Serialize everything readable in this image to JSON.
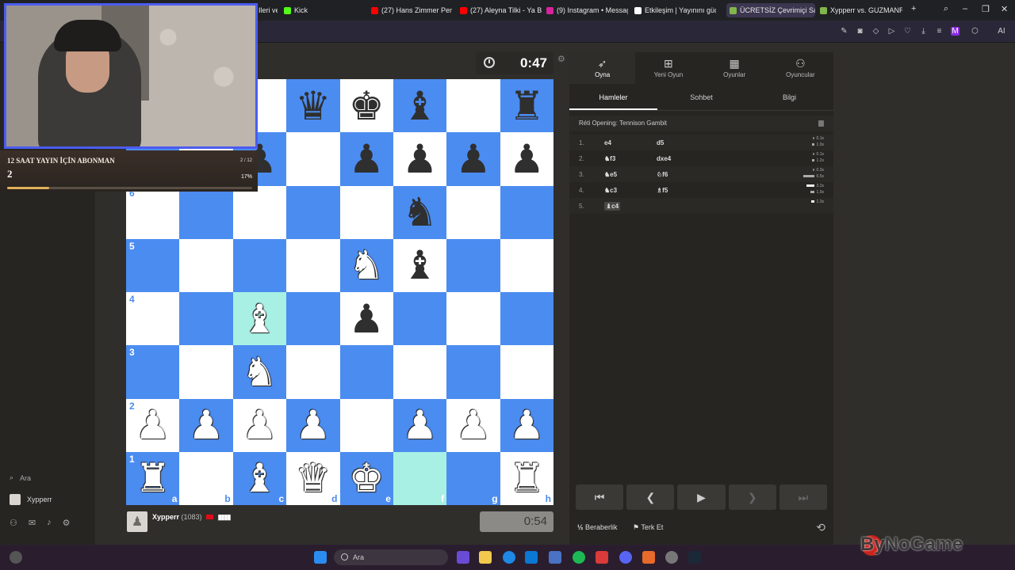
{
  "browser": {
    "tabs": [
      {
        "label": "Ileri ve",
        "icon": "tab-icon"
      },
      {
        "label": "Kick",
        "icon": "kick-icon"
      },
      {
        "label": "(27) Hans Zimmer Per",
        "icon": "youtube-icon"
      },
      {
        "label": "(27) Aleyna Tilki - Ya Bu",
        "icon": "youtube-icon"
      },
      {
        "label": "(9) Instagram • Messages",
        "icon": "instagram-icon"
      },
      {
        "label": "Etkileşim | Yayınını güçlen",
        "icon": "tab-icon"
      },
      {
        "label": "ÜCRETSİZ Çevrimiçi Sa",
        "icon": "chess-icon"
      },
      {
        "label": "Xypperr vs. GUZMANRIC",
        "icon": "chess-icon"
      }
    ],
    "active_tab_index": 6,
    "new_tab_label": "+",
    "ai_label": "AI",
    "profile_initial": "M"
  },
  "webcam": {
    "sub_goal_title": "12 SAAT YAYIN İÇİN ABONMAN",
    "sub_goal_count": "2",
    "sub_goal_fraction": "2 / 12",
    "sub_goal_percent": "17%",
    "sub_goal_progress": 0.17
  },
  "game": {
    "top_clock": "0:47",
    "bottom_clock": "0:54",
    "bottom_player": {
      "name": "Xypperr",
      "rating": "(1083)"
    },
    "board": [
      [
        "",
        "",
        "",
        "bQ",
        "bK",
        "bB",
        "",
        "bR"
      ],
      [
        "",
        "",
        "bP",
        "",
        "bP",
        "bP",
        "bP",
        "bP"
      ],
      [
        "",
        "",
        "",
        "",
        "",
        "bN",
        "",
        ""
      ],
      [
        "",
        "",
        "",
        "",
        "wN",
        "bB",
        "",
        ""
      ],
      [
        "",
        "",
        "wB",
        "",
        "bP",
        "",
        "",
        ""
      ],
      [
        "",
        "",
        "wN",
        "",
        "",
        "",
        "",
        ""
      ],
      [
        "wP",
        "wP",
        "wP",
        "wP",
        "",
        "wP",
        "wP",
        "wP"
      ],
      [
        "wR",
        "",
        "wB",
        "wQ",
        "wK",
        "",
        "",
        "wR"
      ]
    ],
    "highlighted_squares": [
      "c4",
      "f1"
    ],
    "rank_labels": [
      "8",
      "7",
      "6",
      "5",
      "4",
      "3",
      "2",
      "1"
    ],
    "file_labels": [
      "a",
      "b",
      "c",
      "d",
      "e",
      "f",
      "g",
      "h"
    ]
  },
  "right_panel": {
    "top_nav": [
      {
        "label": "Oyna",
        "icon": "rocket-icon",
        "active": true
      },
      {
        "label": "Yeni Oyun",
        "icon": "plus-icon",
        "active": false
      },
      {
        "label": "Oyunlar",
        "icon": "board-icon",
        "active": false
      },
      {
        "label": "Oyuncular",
        "icon": "players-icon",
        "active": false
      }
    ],
    "tabs": [
      {
        "label": "Hamleler",
        "active": true
      },
      {
        "label": "Sohbet",
        "active": false
      },
      {
        "label": "Bilgi",
        "active": false
      }
    ],
    "opening": "Réti Opening: Tennison Gambit",
    "moves": [
      {
        "num": "1.",
        "white": "e4",
        "black": "d5",
        "t1": "0.1s",
        "t2": "1.0s"
      },
      {
        "num": "2.",
        "white": "♞f3",
        "black": "dxe4",
        "t1": "0.1s",
        "t2": "1.2s"
      },
      {
        "num": "3.",
        "white": "♞e5",
        "black": "♘f6",
        "t1": "0.3s",
        "t2": "6.5s"
      },
      {
        "num": "4.",
        "white": "♞c3",
        "black": "♗f5",
        "t1": "3.2s",
        "t2": "1.9s"
      },
      {
        "num": "5.",
        "white": "♝c4",
        "black": "",
        "t1": "1.3s",
        "t2": ""
      }
    ],
    "draw_label": "Beraberlik",
    "resign_label": "Terk Et"
  },
  "left_nav": {
    "search_label": "Ara",
    "username": "Xypperr"
  },
  "taskbar": {
    "search_placeholder": "Ara"
  },
  "watermark": "ByNoGame",
  "colors": {
    "board_light": "#ffffff",
    "board_dark": "#4b8cf0",
    "highlight": "#a8f0e4",
    "webcam_border": "#4b5cf0"
  }
}
